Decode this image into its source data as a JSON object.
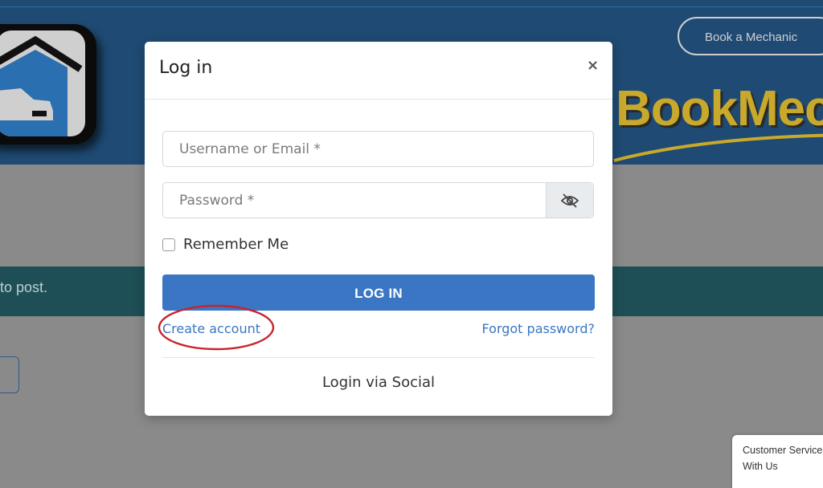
{
  "header": {
    "book_button": "Book a Mechanic",
    "brand_text": "BookMec"
  },
  "notice": {
    "text": "to post."
  },
  "customer_service": {
    "line1": "Customer Services",
    "line2": "With Us"
  },
  "modal": {
    "title": "Log in",
    "close": "×",
    "username_placeholder": "Username or Email *",
    "password_placeholder": "Password *",
    "password_toggle_icon": "eye-slash-icon",
    "remember_label": "Remember Me",
    "remember_checked": false,
    "login_button": "LOG IN",
    "create_account": "Create account",
    "forgot_password": "Forgot password?",
    "social_label": "Login via Social"
  },
  "colors": {
    "primary": "#3a76c4",
    "annotation": "#c8232b"
  }
}
